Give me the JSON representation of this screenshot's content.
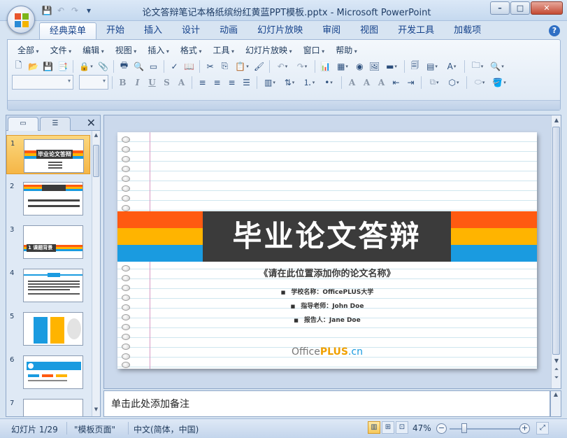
{
  "window": {
    "title": "论文答辩笔记本格纸缤纷红黄蓝PPT模板.pptx - Microsoft PowerPoint",
    "controls": {
      "minimize": "–",
      "maximize": "□",
      "close": "✕"
    }
  },
  "ribbon_tabs": [
    "经典菜单",
    "开始",
    "插入",
    "设计",
    "动画",
    "幻灯片放映",
    "审阅",
    "视图",
    "开发工具",
    "加载项"
  ],
  "menu": [
    "全部",
    "文件",
    "编辑",
    "视图",
    "插入",
    "格式",
    "工具",
    "幻灯片放映",
    "窗口",
    "帮助"
  ],
  "panel": {
    "close": "✕"
  },
  "slides": [
    {
      "num": "1",
      "title": "毕业论文答辩"
    },
    {
      "num": "2"
    },
    {
      "num": "3",
      "title": "1 课题背景"
    },
    {
      "num": "4"
    },
    {
      "num": "5"
    },
    {
      "num": "6"
    },
    {
      "num": "7"
    }
  ],
  "slide": {
    "title": "毕业论文答辩",
    "subtitle": "《请在此位置添加你的论文名称》",
    "school": "学校名称：OfficePLUS大学",
    "advisor": "指导老师：John Doe",
    "reporter": "报告人：Jane Doe",
    "brand_office": "Office",
    "brand_plus": "PLUS",
    "brand_cn": ".cn"
  },
  "notes": {
    "placeholder": "单击此处添加备注"
  },
  "status": {
    "slide_count": "幻灯片 1/29",
    "theme": "\"模板页面\"",
    "language": "中文(简体，中国)",
    "zoom": "47%"
  },
  "colors": {
    "band_red": "#ff5a11",
    "band_yellow": "#ffb400",
    "band_blue": "#1a9be0",
    "title_bg": "#3b3b3b"
  }
}
